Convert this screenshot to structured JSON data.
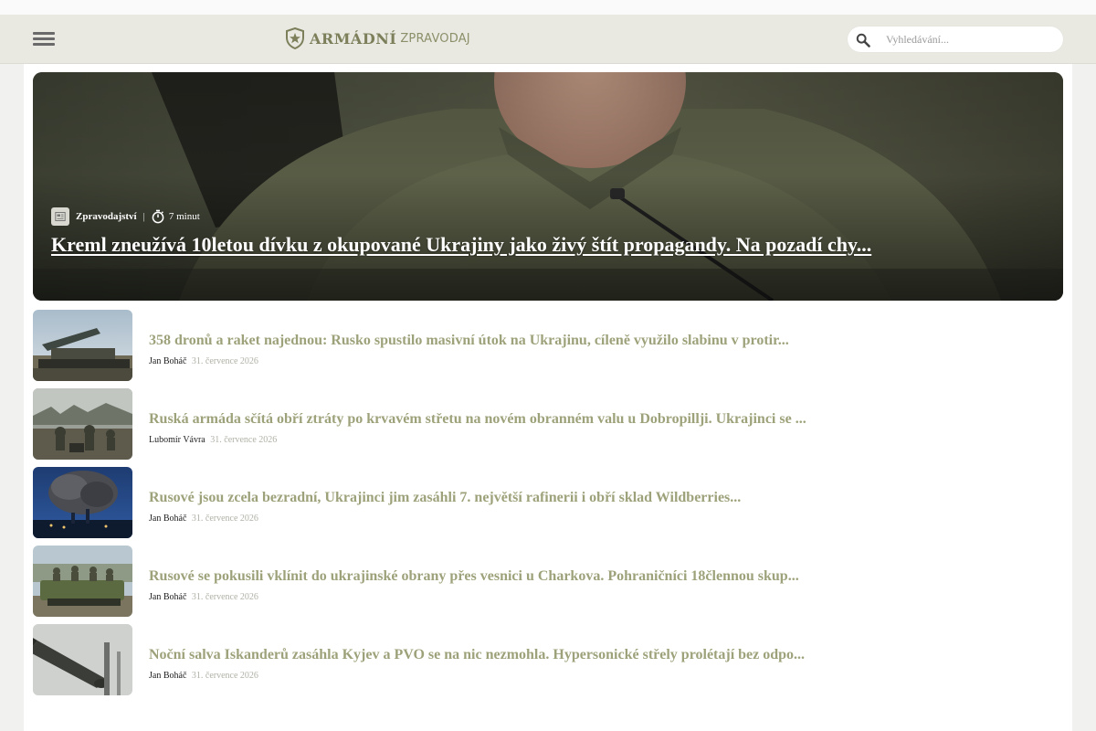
{
  "colors": {
    "header_bg": "#e9e9e2",
    "accent_olive": "#9ea27a",
    "logo_olive": "#7c7f5a",
    "date_gray": "#b0b0a6"
  },
  "header": {
    "menu_icon": "hamburger-menu-icon",
    "logo": {
      "main": "ARMÁDNÍ",
      "sub": "ZPRAVODAJ",
      "icon": "star-shield-icon"
    },
    "search": {
      "placeholder": "Vyhledávání...",
      "value": "",
      "icon": "search-icon"
    }
  },
  "hero": {
    "category": "Zpravodajství",
    "category_icon": "newspaper-icon",
    "separator": "|",
    "read_time": "7 minut",
    "read_time_icon": "stopwatch-icon",
    "title": "Kreml zneužívá 10letou dívku z okupované Ukrajiny jako živý štít propagandy. Na pozadí chy..."
  },
  "articles": [
    {
      "title": "358 dronů a raket najednou: Rusko spustilo masivní útok na Ukrajinu, cíleně využilo slabinu v protir...",
      "author": "Jan Boháč",
      "date": "31. července 2026"
    },
    {
      "title": "Ruská armáda sčítá obří ztráty po krvavém střetu na novém obranném valu u Dobropillji. Ukrajinci se ...",
      "author": "Lubomír Vávra",
      "date": "31. července 2026"
    },
    {
      "title": "Rusové jsou zcela bezradní, Ukrajinci jim zasáhli 7. největší rafinerii i obří sklad Wildberries...",
      "author": "Jan Boháč",
      "date": "31. července 2026"
    },
    {
      "title": "Rusové se pokusili vklínit do ukrajinské obrany přes vesnici u Charkova. Pohraničníci 18člennou skup...",
      "author": "Jan Boháč",
      "date": "31. července 2026"
    },
    {
      "title": "Noční salva Iskanderů zasáhla Kyjev a PVO se na nic nezmohla. Hypersonické střely prolétají bez odpo...",
      "author": "Jan Boháč",
      "date": "31. července 2026"
    }
  ]
}
